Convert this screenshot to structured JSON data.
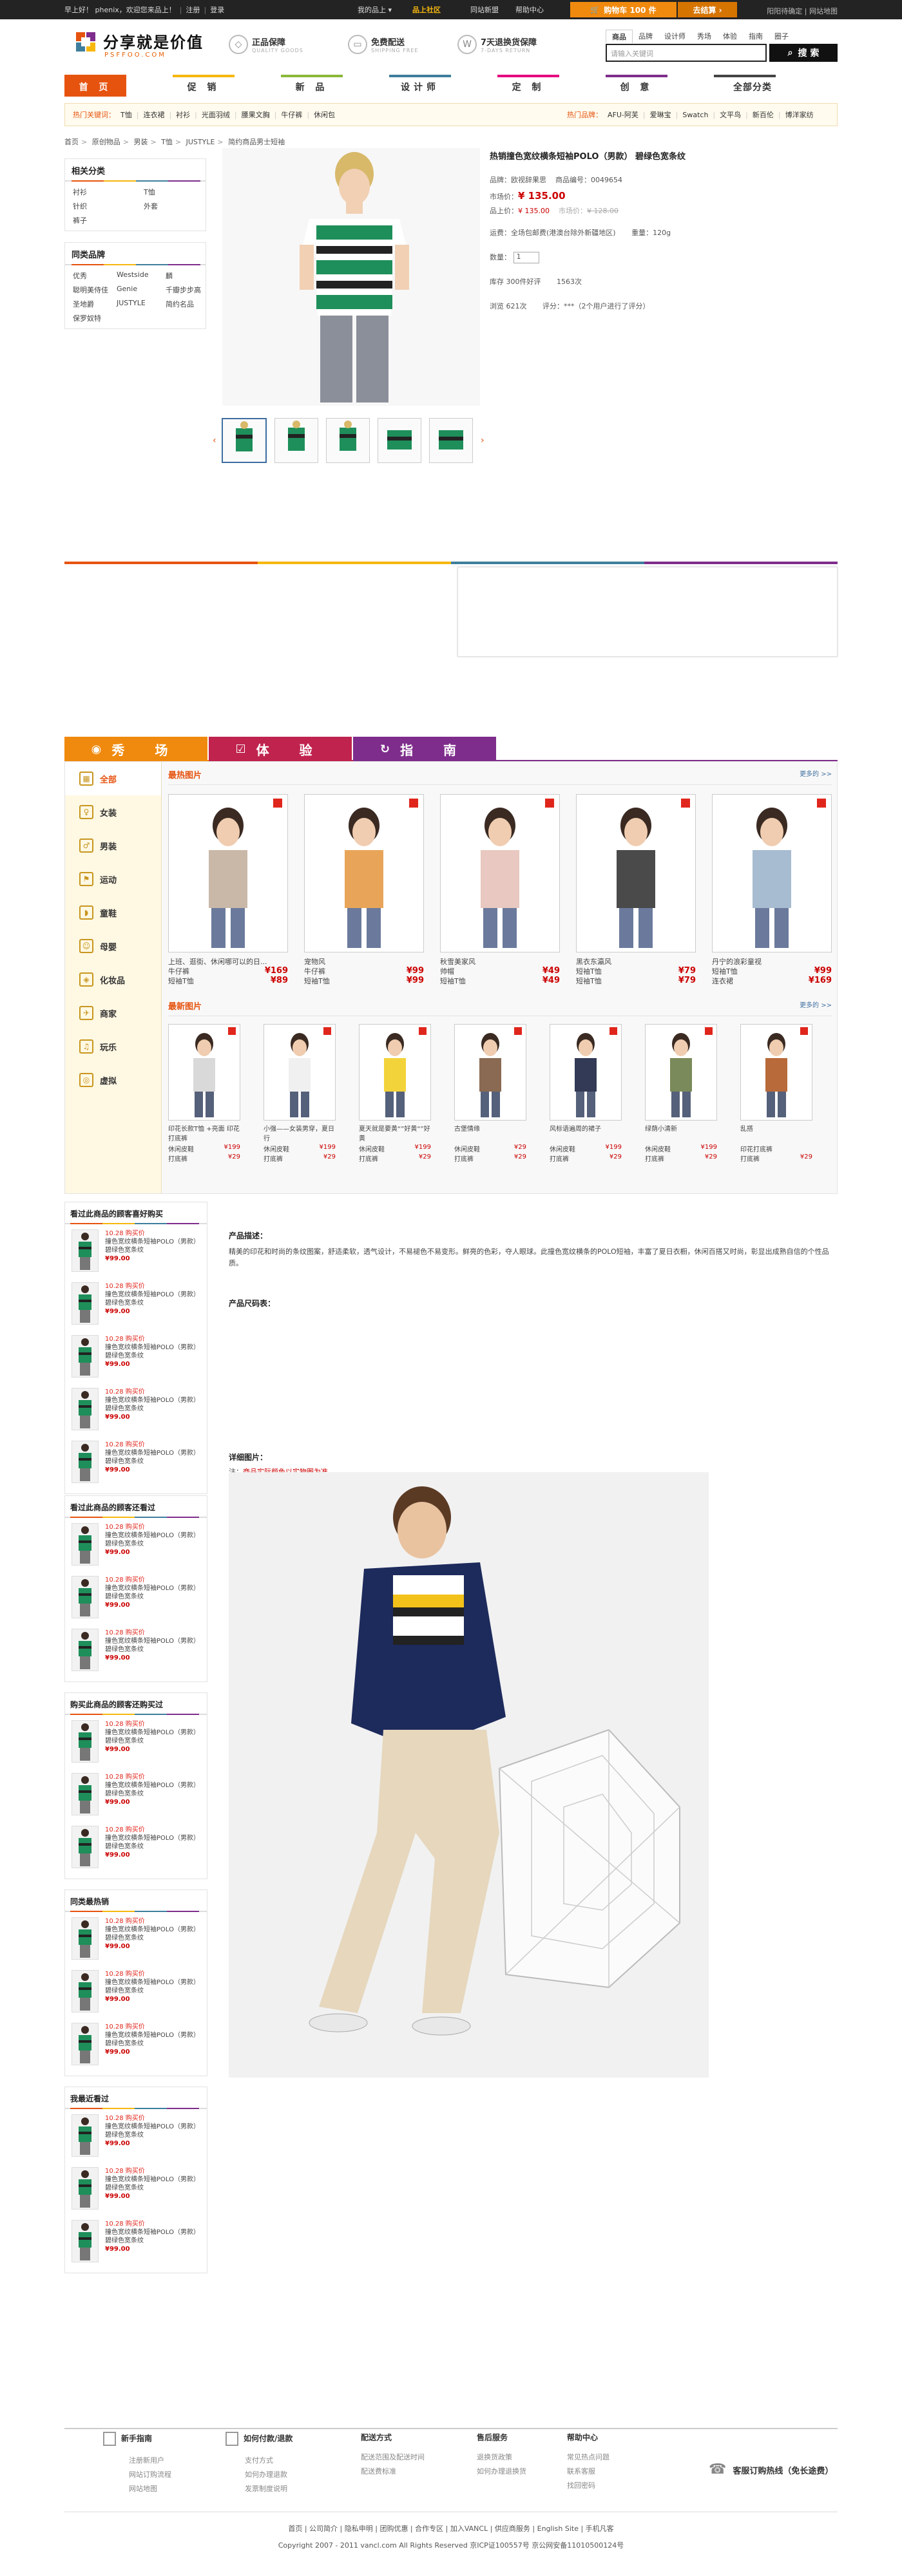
{
  "topbar": {
    "welcome": "早上好！ phenix，欢迎您来品上！",
    "links": [
      "注册",
      "登录"
    ],
    "my_pinshang": "我的品上 ▾",
    "community": "品上社区",
    "favorites": "同站新盟",
    "help": "帮助中心",
    "cart": "购物车 100 件",
    "checkout": "去结算 ›",
    "right": "阳阳待确定 | 网站地图"
  },
  "header": {
    "logo_title": "分享就是价值",
    "logo_sub": "PSFFOO.COM",
    "badges": [
      {
        "icon": "diamond-icon",
        "t1": "正品保障",
        "t2": "QUALITY GOODS"
      },
      {
        "icon": "truck-icon",
        "t1": "免费配送",
        "t2": "SHIPPING FREE"
      },
      {
        "icon": "return-icon",
        "t1": "7天退换货保障",
        "t2": "7-DAYS RETURN"
      }
    ],
    "search_tabs": [
      "商品",
      "品牌",
      "设计师",
      "秀场",
      "体验",
      "指南",
      "圈子"
    ],
    "search_placeholder": "请输入关键词",
    "search_button": "搜 索"
  },
  "nav": {
    "items": [
      "首 页",
      "促 销",
      "新 品",
      "设计师",
      "定 制",
      "创 意",
      "全部分类"
    ],
    "colors": [
      "#e6530f",
      "#f6b70e",
      "#8ab83a",
      "#3e7e9c",
      "#e5007f",
      "#7f2d8c",
      "#444444"
    ]
  },
  "hotbar": {
    "label": "热门关键词：",
    "keywords": [
      "T恤",
      "连衣裙",
      "衬衫",
      "光面羽绒",
      "腰果文胸",
      "牛仔裤",
      "休闲包"
    ],
    "brand_label": "热门品牌：",
    "brands": [
      "AFU-阿芙",
      "爱琳宝",
      "Swatch",
      "文平鸟",
      "新百伦",
      "博洋家纺"
    ]
  },
  "breadcrumb": [
    "首页",
    "原创物品",
    "男装",
    "T恤",
    "JUSTYLE",
    "简约商品男士短袖"
  ],
  "sidebar_related": {
    "title": "相关分类",
    "items": [
      "衬衫",
      "T恤",
      "针织",
      "外套",
      "裤子"
    ]
  },
  "sidebar_brands": {
    "title": "同类品牌",
    "items": [
      "优秀",
      "Westside",
      "麟",
      "聪明美侍佳",
      "Genie",
      "千瓣步步高",
      "圣地爵",
      "JUSTYLE",
      "简约名品",
      "保罗奴特"
    ]
  },
  "product": {
    "title": "热销撞色宽纹横条短袖POLO（男款） 碧绿色宽条纹",
    "brand_label": "品牌：",
    "brand": "欧视辞果思",
    "code_label": "商品编号：",
    "code": "0049654",
    "market_label": "市场价：",
    "market_price": "¥ 135.00",
    "vip_label": "品上价：",
    "vip_price": "¥ 135.00",
    "vip_note": "市场价：",
    "orig_price": "¥ 128.00",
    "ship_label": "运费：",
    "ship_text": "全场包邮费(港澳台除外新疆地区)",
    "weight_label": "重量：",
    "weight": "120g",
    "qty_label": "数量：",
    "qty": "1",
    "stock_label": "库存",
    "stock_text": "300件好评",
    "stock_num": "1563次",
    "comment_label": "浏览",
    "comment_text": "621次",
    "rating_label": "评分：",
    "rating_text": "***（2个用户进行了评分）"
  },
  "show": {
    "tabs": [
      "秀 场",
      "体 验",
      "指 南"
    ],
    "tab_colors": [
      "#f08a0e",
      "#c0244e",
      "#7f2d8c"
    ],
    "menu": [
      {
        "label": "全部",
        "icon": "grid-icon"
      },
      {
        "label": "女装",
        "icon": "dress-icon"
      },
      {
        "label": "男装",
        "icon": "shirt-icon"
      },
      {
        "label": "运动",
        "icon": "sneaker-icon"
      },
      {
        "label": "童鞋",
        "icon": "shoe-icon"
      },
      {
        "label": "母婴",
        "icon": "baby-icon"
      },
      {
        "label": "化妆品",
        "icon": "cosmetics-icon"
      },
      {
        "label": "商家",
        "icon": "plane-icon"
      },
      {
        "label": "玩乐",
        "icon": "play-icon"
      },
      {
        "label": "虚拟",
        "icon": "virtual-icon"
      }
    ],
    "hot_title": "最热图片",
    "hot_more": "更多的 >>",
    "hot": [
      {
        "cap": "上班、逛街、休闲哪可以的日...",
        "l1": "牛仔裤",
        "p1": "¥169",
        "l2": "短袖T恤",
        "p2": "¥89"
      },
      {
        "cap": "宠物风",
        "l1": "牛仔裤",
        "p1": "¥99",
        "l2": "短袖T恤",
        "p2": "¥99"
      },
      {
        "cap": "秋雪美家风",
        "l1": "帅帽",
        "p1": "¥49",
        "l2": "短袖T恤",
        "p2": "¥49"
      },
      {
        "cap": "黑衣东瀛风",
        "l1": "短袖T恤",
        "p1": "¥79",
        "l2": "短袖T恤",
        "p2": "¥79"
      },
      {
        "cap": "丹宁的浪彩童视",
        "l1": "短袖T恤",
        "p1": "¥99",
        "l2": "连衣裙",
        "p2": "¥169"
      }
    ],
    "new_title": "最新图片",
    "new_more": "更多的 >>",
    "new": [
      {
        "cap": "印花长款T恤 +亮面 印花打底裤",
        "l1": "休闲皮鞋",
        "p1": "¥199",
        "l2": "打底裤",
        "p2": "¥29"
      },
      {
        "cap": "小强——女装男穿，夏日行",
        "l1": "休闲皮鞋",
        "p1": "¥199",
        "l2": "打底裤",
        "p2": "¥29"
      },
      {
        "cap": "夏天就是要黄“”好黄“”好黄",
        "l1": "休闲皮鞋",
        "p1": "¥199",
        "l2": "打底裤",
        "p2": "¥29"
      },
      {
        "cap": "古堡情缘",
        "l1": "休闲皮鞋",
        "p1": "¥29",
        "l2": "打底裤",
        "p2": "¥29"
      },
      {
        "cap": "风标语遍周的裙子",
        "l1": "休闲皮鞋",
        "p1": "¥199",
        "l2": "打底裤",
        "p2": "¥29"
      },
      {
        "cap": "绿荫小清新",
        "l1": "休闲皮鞋",
        "p1": "¥199",
        "l2": "打底裤",
        "p2": "¥29"
      },
      {
        "cap": "乱搭",
        "l1": "印花打底裤",
        "p1": "",
        "l2": "打底裤",
        "p2": "¥29"
      }
    ]
  },
  "rec_boxes": [
    {
      "title": "看过此商品的顾客喜好购买",
      "items": [
        {
          "promo": "10.28 购买价",
          "text": "撞色宽纹横条短袖POLO（男款）碧绿色宽条纹",
          "price": "¥99.00"
        },
        {
          "promo": "10.28 购买价",
          "text": "撞色宽纹横条短袖POLO（男款）碧绿色宽条纹",
          "price": "¥99.00"
        },
        {
          "promo": "10.28 购买价",
          "text": "撞色宽纹横条短袖POLO（男款）碧绿色宽条纹",
          "price": "¥99.00"
        },
        {
          "promo": "10.28 购买价",
          "text": "撞色宽纹横条短袖POLO（男款）碧绿色宽条纹",
          "price": "¥99.00"
        },
        {
          "promo": "10.28 购买价",
          "text": "撞色宽纹横条短袖POLO（男款）碧绿色宽条纹",
          "price": "¥99.00"
        }
      ]
    },
    {
      "title": "看过此商品的顾客还看过",
      "items": [
        {
          "promo": "10.28 购买价",
          "text": "撞色宽纹横条短袖POLO（男款）碧绿色宽条纹",
          "price": "¥99.00"
        },
        {
          "promo": "10.28 购买价",
          "text": "撞色宽纹横条短袖POLO（男款）碧绿色宽条纹",
          "price": "¥99.00"
        },
        {
          "promo": "10.28 购买价",
          "text": "撞色宽纹横条短袖POLO（男款）碧绿色宽条纹",
          "price": "¥99.00"
        }
      ]
    },
    {
      "title": "购买此商品的顾客还购买过",
      "items": [
        {
          "promo": "10.28 购买价",
          "text": "撞色宽纹横条短袖POLO（男款）碧绿色宽条纹",
          "price": "¥99.00"
        },
        {
          "promo": "10.28 购买价",
          "text": "撞色宽纹横条短袖POLO（男款）碧绿色宽条纹",
          "price": "¥99.00"
        },
        {
          "promo": "10.28 购买价",
          "text": "撞色宽纹横条短袖POLO（男款）碧绿色宽条纹",
          "price": "¥99.00"
        }
      ]
    },
    {
      "title": "同类最热销",
      "items": [
        {
          "promo": "10.28 购买价",
          "text": "撞色宽纹横条短袖POLO（男款）碧绿色宽条纹",
          "price": "¥99.00"
        },
        {
          "promo": "10.28 购买价",
          "text": "撞色宽纹横条短袖POLO（男款）碧绿色宽条纹",
          "price": "¥99.00"
        },
        {
          "promo": "10.28 购买价",
          "text": "撞色宽纹横条短袖POLO（男款）碧绿色宽条纹",
          "price": "¥99.00"
        }
      ]
    },
    {
      "title": "我最近看过",
      "items": [
        {
          "promo": "10.28 购买价",
          "text": "撞色宽纹横条短袖POLO（男款）碧绿色宽条纹",
          "price": "¥99.00"
        },
        {
          "promo": "10.28 购买价",
          "text": "撞色宽纹横条短袖POLO（男款）碧绿色宽条纹",
          "price": "¥99.00"
        },
        {
          "promo": "10.28 购买价",
          "text": "撞色宽纹横条短袖POLO（男款）碧绿色宽条纹",
          "price": "¥99.00"
        }
      ]
    }
  ],
  "detail": {
    "desc_title": "产品描述：",
    "desc_text": "精美的印花和时尚的条纹图案，舒适柔软，透气设计，不易褪色不易变形。鲜亮的色彩，夺人眼球。此撞色宽纹横条的POLO短袖，丰富了夏日衣橱，休闲百搭又时尚，彰显出成熟自信的个性品质。",
    "size_title": "产品尺码表：",
    "img_title": "详细图片：",
    "img_note_prefix": "注：",
    "img_note": "商品实际颜色以实物图为准"
  },
  "footer": {
    "cols": [
      {
        "title": "新手指南",
        "links": [
          "注册新用户",
          "网站订购流程",
          "网站地图"
        ]
      },
      {
        "title": "如何付款/退款",
        "links": [
          "支付方式",
          "如何办理退款",
          "发票制度说明"
        ]
      },
      {
        "title": "配送方式",
        "links": [
          "配送范围及配送时间",
          "配送费标准",
          ""
        ]
      },
      {
        "title": "售后服务",
        "links": [
          "退换货政策",
          "如何办理退换货",
          ""
        ]
      },
      {
        "title": "帮助中心",
        "links": [
          "常见热点问题",
          "联系客服",
          "找回密码"
        ]
      }
    ],
    "hotline": "客服订购热线（免长途费）",
    "links": "首页 | 公司简介 | 隐私申明 | 团购优惠 | 合作专区 | 加入VANCL | 供应商服务 | English Site | 手机凡客",
    "copyright": "Copyright 2007 - 2011 vancl.com All Rights Reserved 京ICP证100557号 京公网安备11010500124号"
  }
}
